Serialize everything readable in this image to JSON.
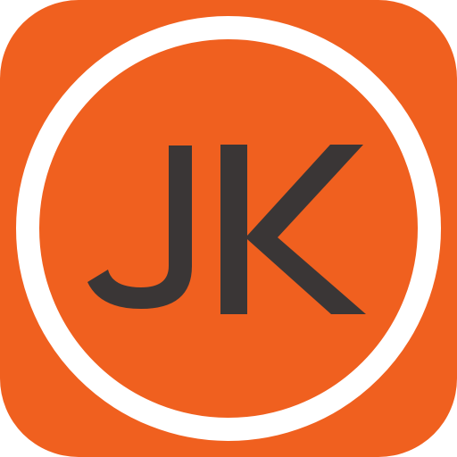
{
  "icon": {
    "monogram": "JK",
    "icon_name": "jk-monogram-app-icon",
    "colors": {
      "background": "#F0601F",
      "ring": "#FFFFFF",
      "letters": "#3A3636"
    }
  }
}
